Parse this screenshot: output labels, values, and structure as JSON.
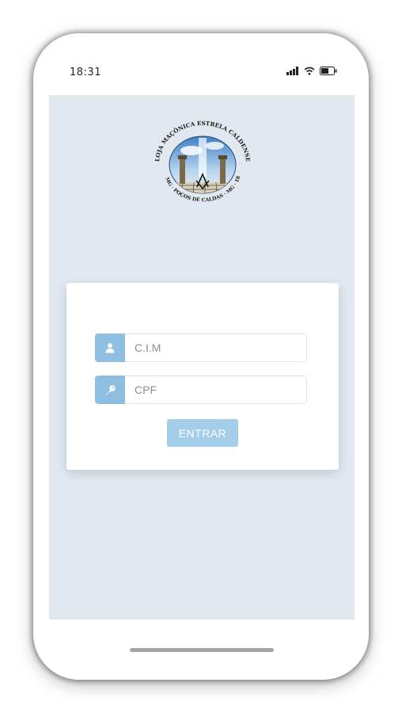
{
  "status_bar": {
    "time": "18:31",
    "icons": [
      "signal-icon",
      "wifi-icon",
      "battery-icon"
    ]
  },
  "logo": {
    "top_text": "LOJA MAÇÔNICA ESTRELA CALDENSE",
    "bottom_text": "GOMG · POÇOS DE CALDAS · MG · 1895"
  },
  "login_form": {
    "cim_placeholder": "C.I.M",
    "cpf_placeholder": "CPF",
    "submit_label": "ENTRAR",
    "user_icon": "user-icon",
    "key_icon": "key-icon"
  },
  "colors": {
    "screen_background": "#e2e8f0",
    "addon": "#8fbfe0",
    "button": "#a4cdea"
  }
}
